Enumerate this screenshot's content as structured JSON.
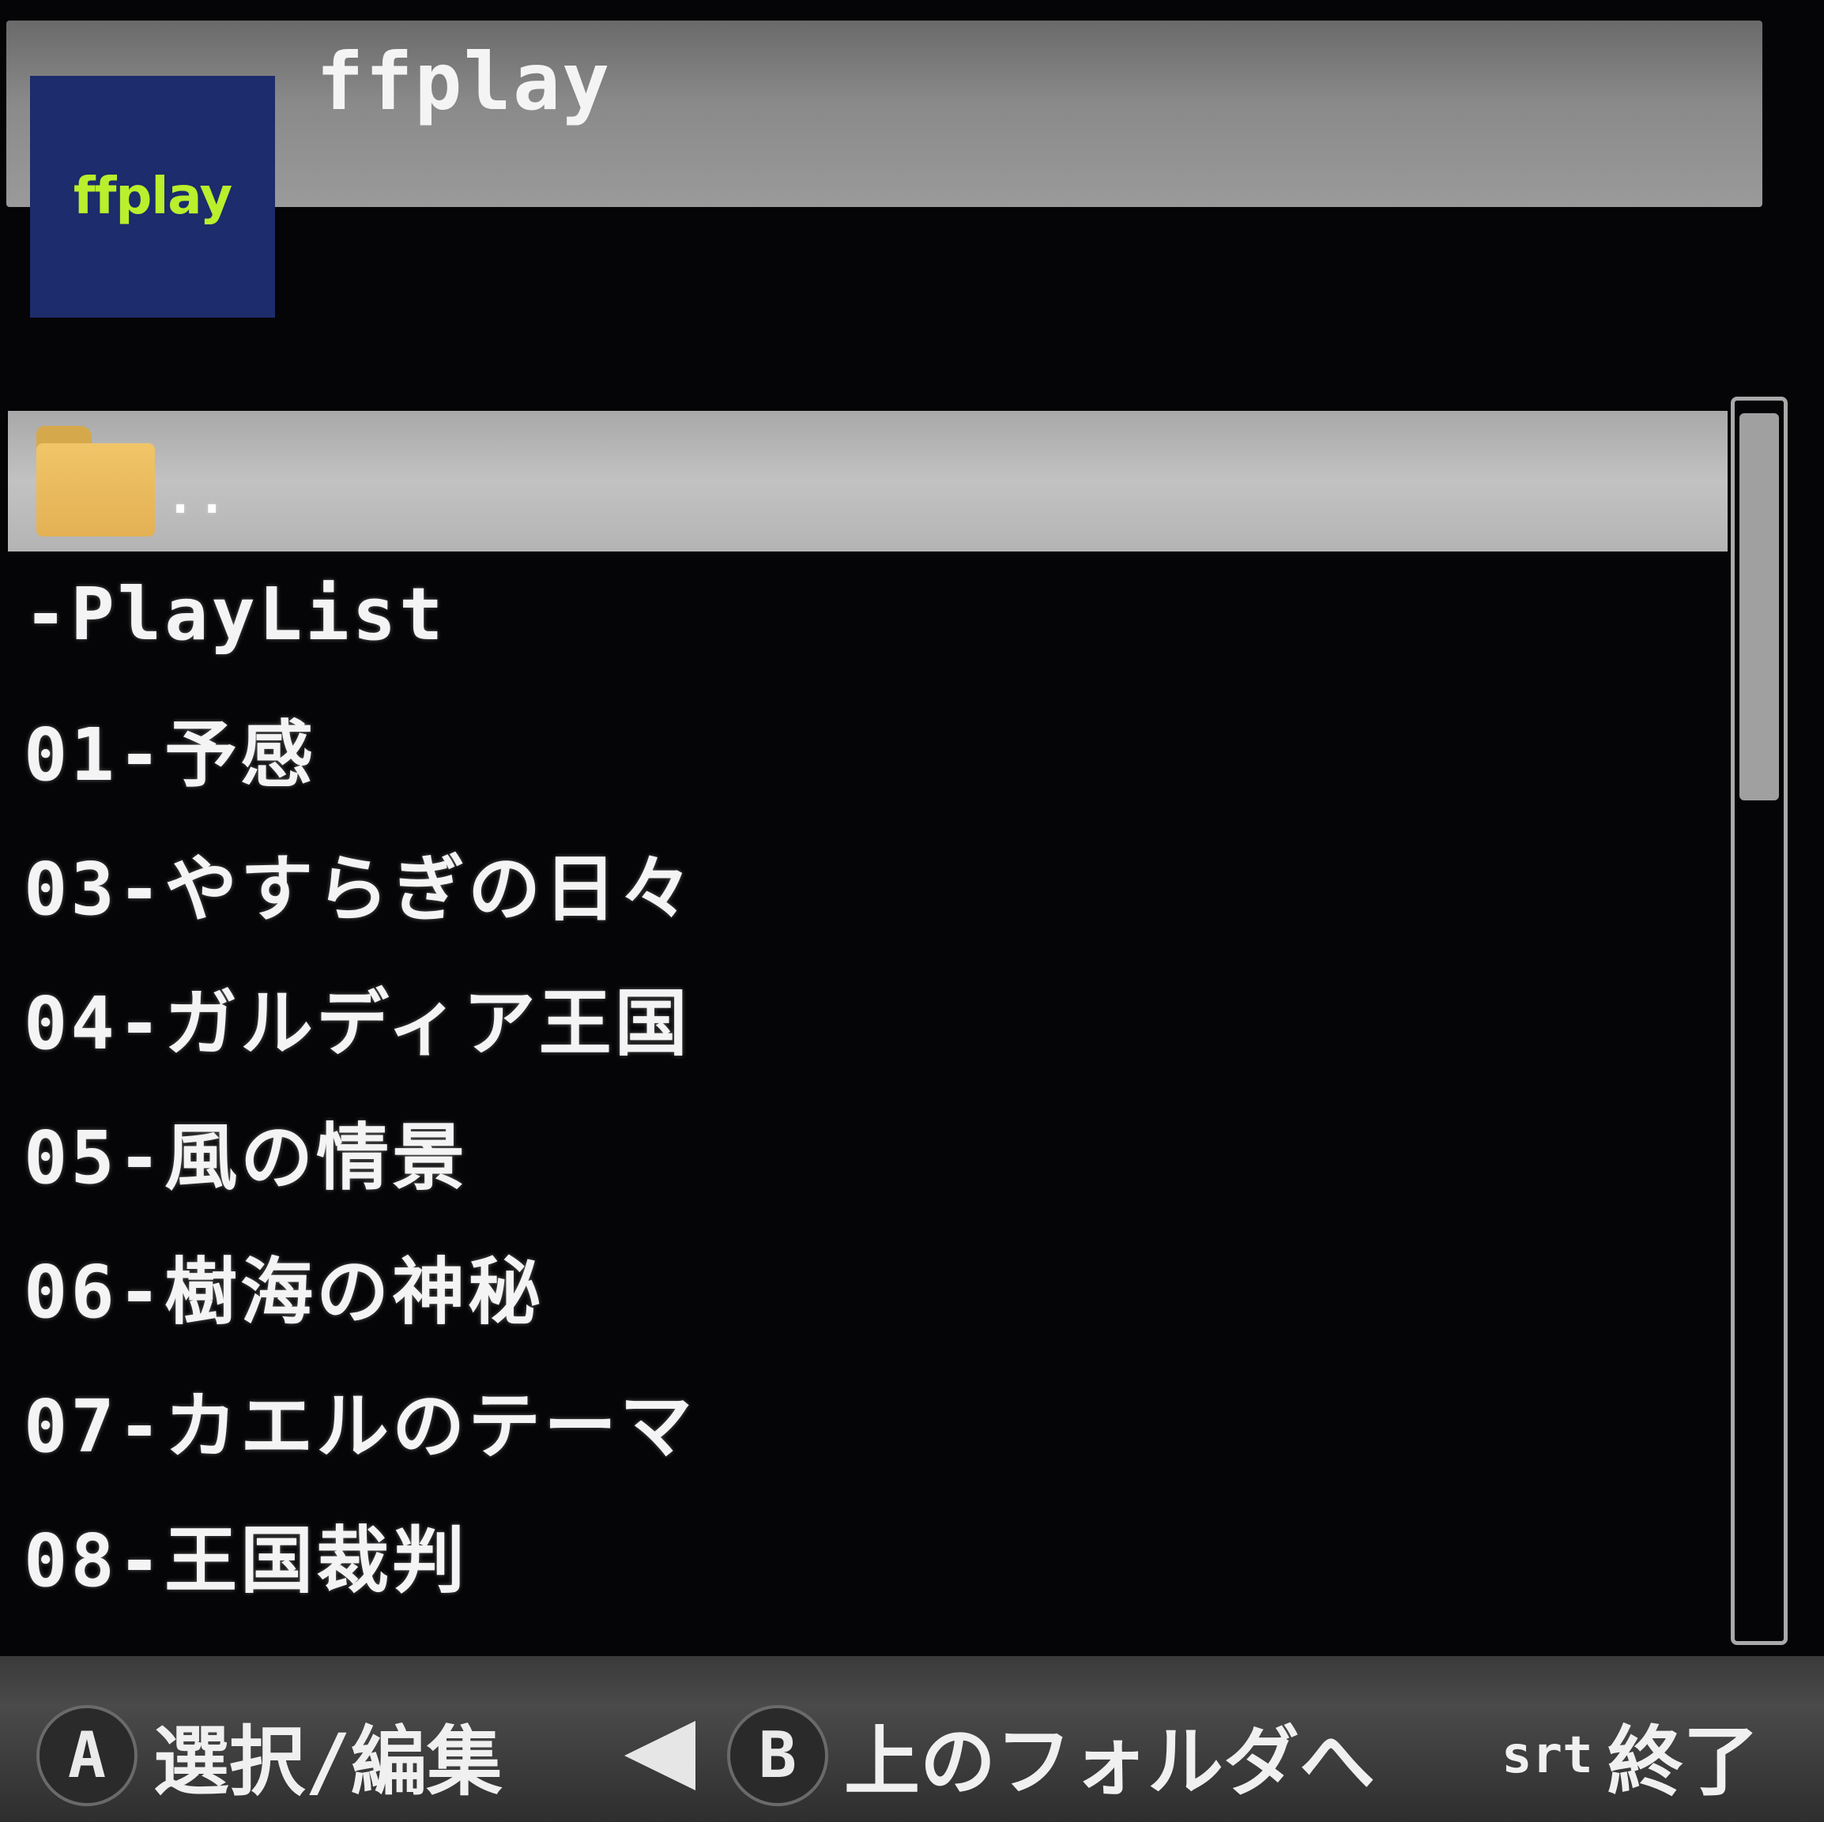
{
  "window": {
    "title": "ffplay",
    "icon_text": "ffplay",
    "icon_color": "#1c2c6c",
    "icon_text_color": "#b9ef2c"
  },
  "file_list": {
    "items": [
      {
        "label": "..",
        "type": "folder",
        "selected": true
      },
      {
        "label": "-PlayList",
        "type": "file"
      },
      {
        "label": "01-予感",
        "type": "file"
      },
      {
        "label": "03-やすらぎの日々",
        "type": "file"
      },
      {
        "label": "04-ガルディア王国",
        "type": "file"
      },
      {
        "label": "05-風の情景",
        "type": "file"
      },
      {
        "label": "06-樹海の神秘",
        "type": "file"
      },
      {
        "label": "07-カエルのテーマ",
        "type": "file"
      },
      {
        "label": "08-王国裁判",
        "type": "file"
      }
    ]
  },
  "footer": {
    "select": {
      "button": "A",
      "label": "選択/編集"
    },
    "back": {
      "button": "B",
      "label": "上のフォルダへ"
    },
    "exit": {
      "button": "srt",
      "label": "終了"
    }
  }
}
